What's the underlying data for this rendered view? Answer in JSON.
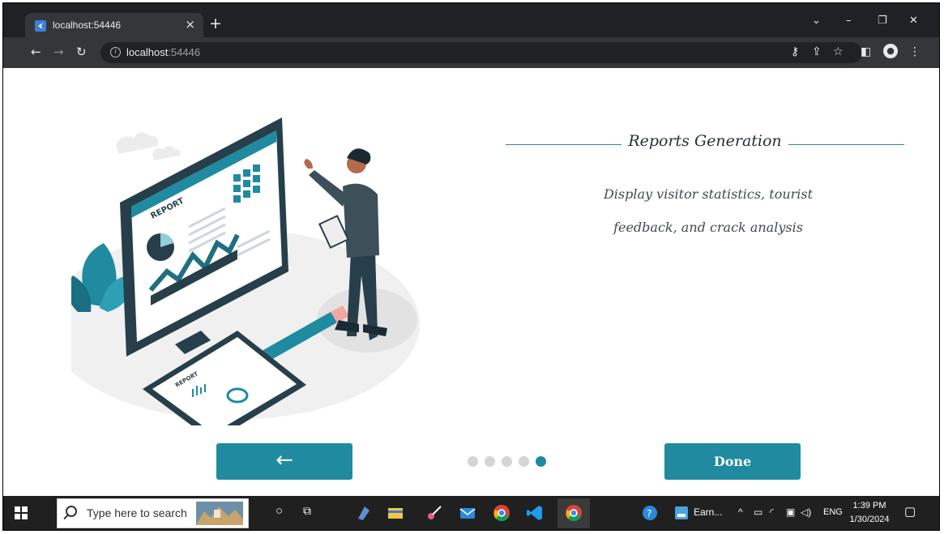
{
  "browser": {
    "tab_title": "localhost:54446",
    "tab_close_icon": "×",
    "new_tab_icon": "+",
    "url_host": "localhost",
    "url_port": ":54446",
    "window_controls": [
      "⌄",
      "–",
      "❐",
      "✕"
    ]
  },
  "slide": {
    "title": "Reports Generation",
    "description_line1": "Display visitor statistics, tourist",
    "description_line2": "feedback, and crack analysis",
    "illustration_text": [
      "REPORT",
      "REPORT"
    ],
    "back_icon": "←",
    "done_label": "Done",
    "page_count": 5,
    "active_page": 5
  },
  "taskbar": {
    "search_placeholder": "Type here to search",
    "pinned_label": "Earn...",
    "language": "ENG",
    "time": "1:39 PM",
    "date": "1/30/2024"
  },
  "colors": {
    "accent": "#1f8aa0",
    "dark_teal": "#263f4a",
    "chrome_dark": "#202124",
    "chrome_toolbar": "#35363a",
    "taskbar": "#202020"
  }
}
